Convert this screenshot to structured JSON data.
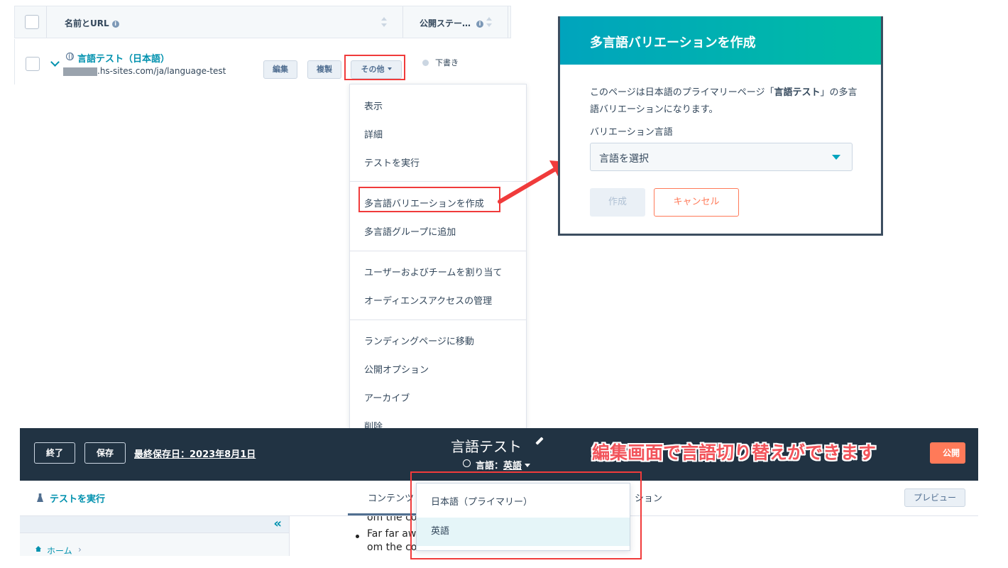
{
  "table": {
    "col_name": "名前とURL",
    "col_status": "公開ステー…",
    "row": {
      "name": "言語テスト（日本語）",
      "url": ".hs-sites.com/ja/language-test",
      "btn_edit": "編集",
      "btn_clone": "複製",
      "btn_more": "その他",
      "status": "下書き"
    }
  },
  "menu": {
    "items": [
      "表示",
      "詳細",
      "テストを実行",
      "多言語バリエーションを作成",
      "多言語グループに追加",
      "ユーザーおよびチームを割り当て",
      "オーディエンスアクセスの管理",
      "ランディングページに移動",
      "公開オプション",
      "アーカイブ",
      "削除"
    ]
  },
  "modal": {
    "title": "多言語バリエーションを作成",
    "desc_pre": "このページは日本語のプライマリーページ「",
    "desc_bold": "言語テスト",
    "desc_post": "」の多言語バリエーションになります。",
    "field_label": "バリエーション言語",
    "select_placeholder": "言語を選択",
    "btn_create": "作成",
    "btn_cancel": "キャンセル"
  },
  "editor": {
    "btn_exit": "終了",
    "btn_save": "保存",
    "last_saved": "最終保存日：2023年8月1日",
    "title": "言語テスト",
    "lang_label": "言語：",
    "lang_value": "英語",
    "annotation": "編集画面で言語切り替えができます",
    "btn_publish": "公開",
    "run_test": "テストを実行",
    "tab_content": "コンテンツ",
    "tab_other": "ション",
    "btn_preview": "プレビュー",
    "breadcrumb_home": "ホーム",
    "body_line1": "om the co",
    "body_line2": "Far far aw",
    "body_line3": "om the countries Vokalia",
    "lang_options": [
      "日本語（プライマリー）",
      "英語"
    ]
  },
  "colors": {
    "accent": "#00a4bd",
    "link": "#0091ae",
    "orange": "#ff7a59",
    "editor_bar": "#213343",
    "annotation_red": "#f03b3b"
  }
}
